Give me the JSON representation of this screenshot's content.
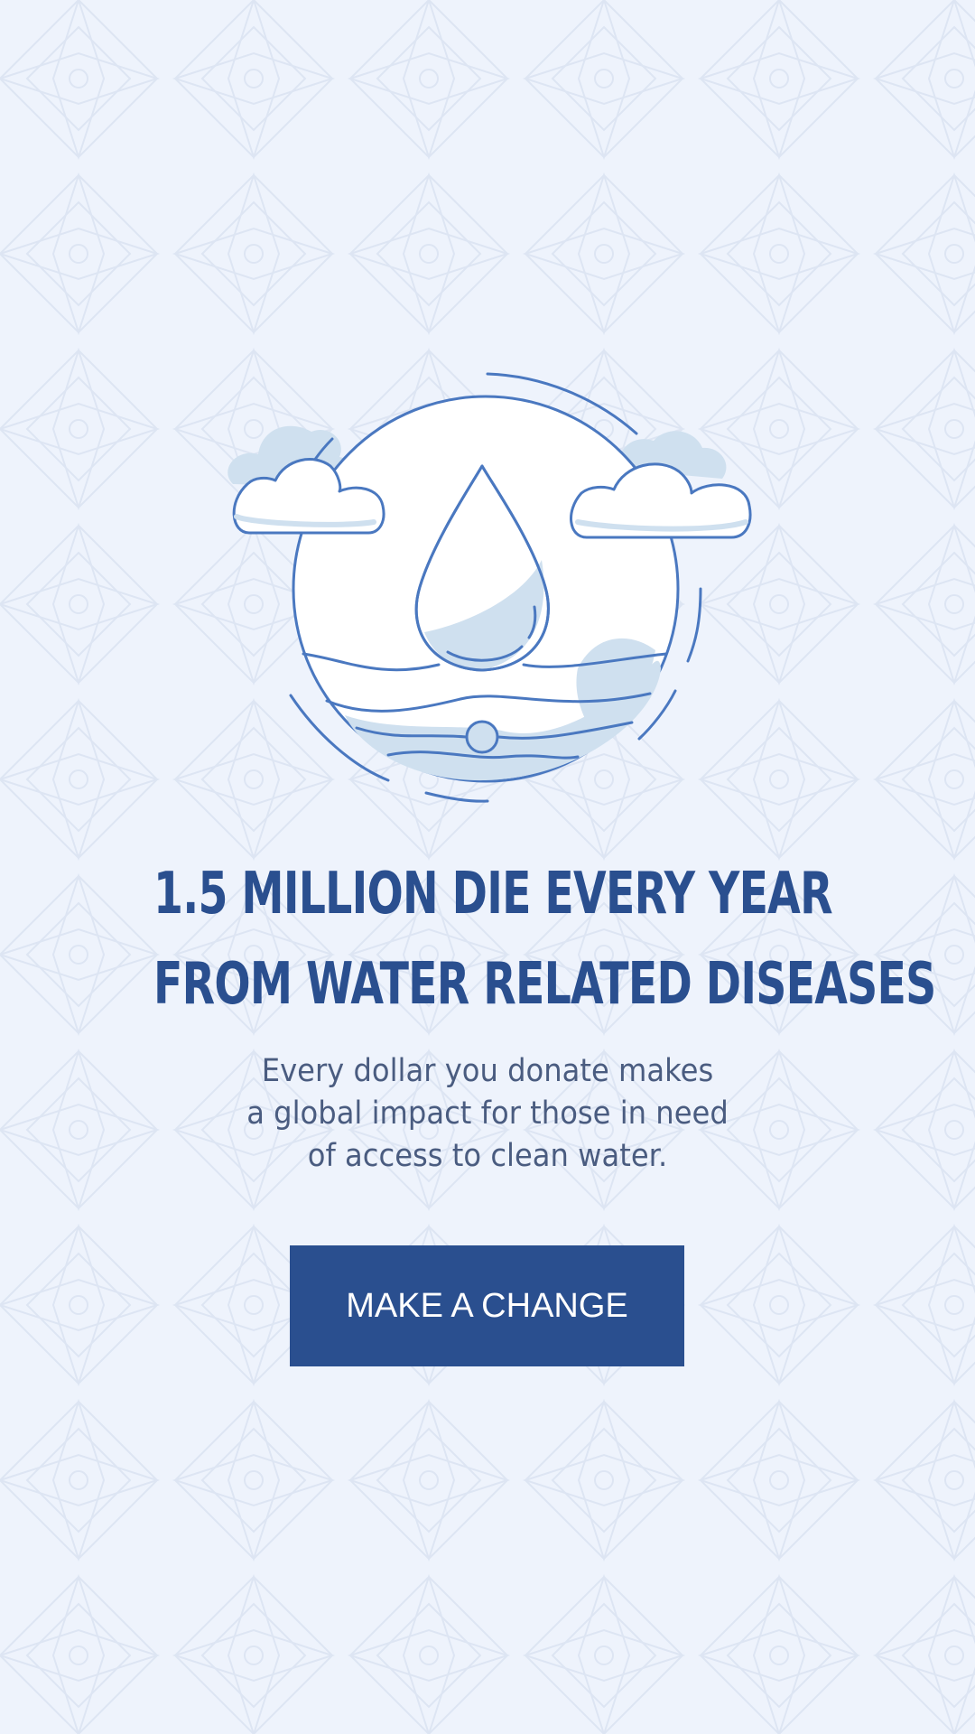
{
  "colors": {
    "background": "#eef3fc",
    "primary": "#2a4f8f",
    "body_text": "#4a5c80",
    "line_art": "#4a78c0",
    "fill_light": "#cfe0ef"
  },
  "illustration": {
    "icon": "water-drop-globe-icon"
  },
  "headline": {
    "line1": "1.5 MILLION DIE EVERY YEAR",
    "line2": "FROM WATER RELATED DISEASES"
  },
  "subtext": {
    "line1": "Every dollar you donate makes",
    "line2": "a global impact for those in need",
    "line3": "of access to clean water."
  },
  "cta": {
    "label": "MAKE A CHANGE"
  }
}
